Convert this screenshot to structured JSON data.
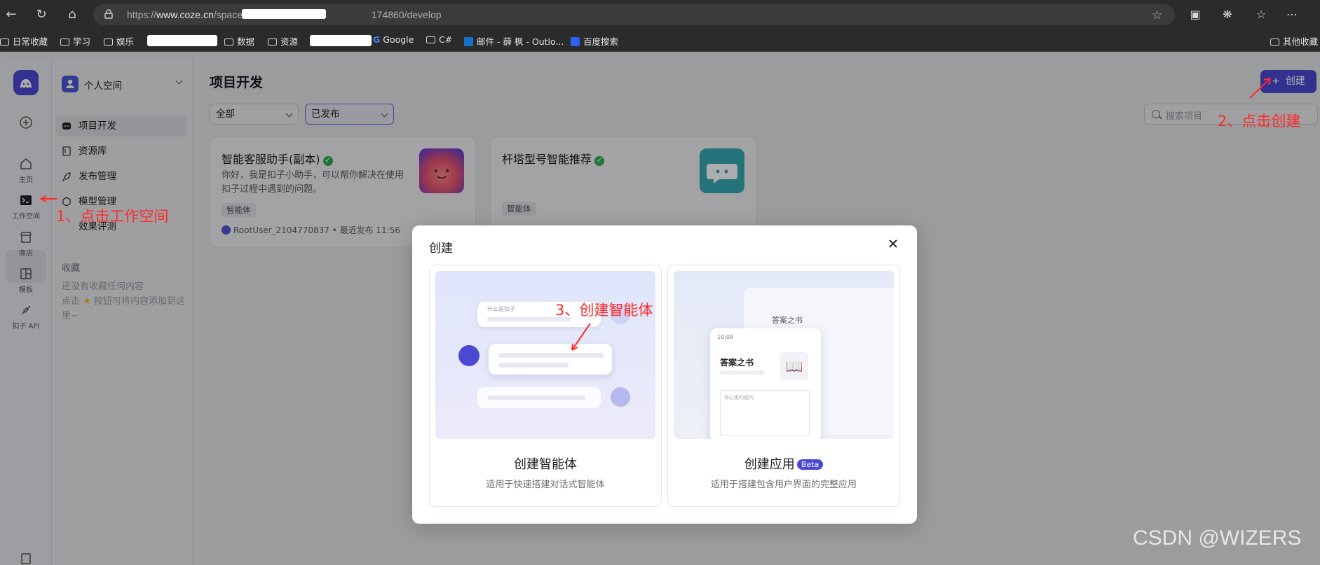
{
  "browser": {
    "url_prefix": "https://",
    "url_host": "www.coze.cn",
    "url_path_start": "/space/",
    "url_path_end": "174860/develop",
    "bookmarks": [
      "日常收藏",
      "学习",
      "娱乐",
      "数据",
      "资源",
      "Google",
      "C#",
      "邮件 - 薛 枫 - Outlo...",
      "百度搜索",
      "其他收藏"
    ]
  },
  "rail": {
    "items": [
      {
        "label": "主页",
        "icon": "home-icon"
      },
      {
        "label": "工作空间",
        "icon": "terminal-icon"
      },
      {
        "label": "商店",
        "icon": "store-icon"
      },
      {
        "label": "模板",
        "icon": "template-icon"
      },
      {
        "label": "扣子 API",
        "icon": "api-icon"
      }
    ]
  },
  "sidebar": {
    "space_name": "个人空间",
    "items": [
      {
        "label": "项目开发",
        "icon": "project-icon"
      },
      {
        "label": "资源库",
        "icon": "library-icon"
      },
      {
        "label": "发布管理",
        "icon": "rocket-icon"
      },
      {
        "label": "模型管理",
        "icon": "model-icon"
      },
      {
        "label": "效果评测",
        "icon": "eval-icon"
      }
    ],
    "favorites_title": "收藏",
    "favorites_empty_1": "还没有收藏任何内容",
    "favorites_empty_2a": "点击",
    "favorites_empty_2b": "按钮可将内容添加到这里~"
  },
  "main": {
    "title": "项目开发",
    "filter_type": "全部",
    "filter_status": "已发布",
    "create_label": "创建",
    "search_placeholder": "搜索项目",
    "cards": [
      {
        "title": "智能客服助手(副本)",
        "desc": "你好，我是扣子小助手，可以帮你解决在使用扣子过程中遇到的问题。",
        "badge": "智能体",
        "meta": "RootUser_2104770837 • 最近发布 11:56"
      },
      {
        "title": "杆塔型号智能推荐",
        "desc": "",
        "badge": "智能体",
        "meta": ""
      }
    ]
  },
  "modal": {
    "title": "创建",
    "options": [
      {
        "title": "创建智能体",
        "subtitle": "适用于快速搭建对话式智能体",
        "art_text": "什么是扣子"
      },
      {
        "title": "创建应用",
        "badge": "Beta",
        "subtitle": "适用于搭建包含用户界面的完整应用",
        "art_title": "答案之书",
        "art_time": "10:09",
        "art_input": "你心里的疑问"
      }
    ]
  },
  "annotations": {
    "step1": "1、点击工作空间",
    "step2": "2、点击创建",
    "step3": "3、创建智能体"
  },
  "watermark": "CSDN @WIZERS",
  "colors": {
    "accent": "#4b49d3",
    "annotation": "#ff2a2a",
    "success": "#2eae55"
  }
}
